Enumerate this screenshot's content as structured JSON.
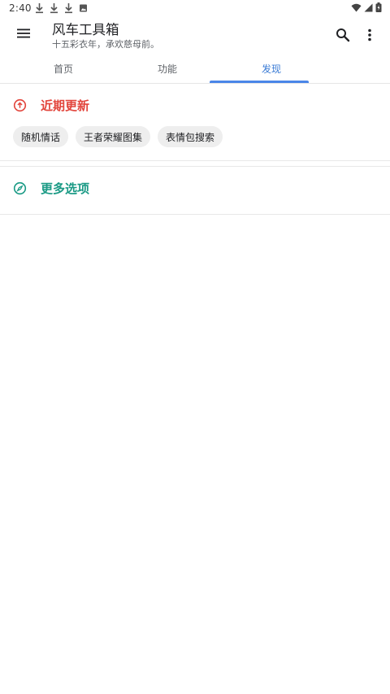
{
  "status_bar": {
    "time": "2:40",
    "left_icons": [
      "download-icon",
      "download-icon",
      "download-icon",
      "image-icon"
    ],
    "right_icons": [
      "wifi-icon",
      "cellular-signal-icon",
      "battery-icon"
    ]
  },
  "app_bar": {
    "title": "风车工具箱",
    "subtitle": "十五彩衣年，承欢慈母前。",
    "menu_icon": "menu-icon",
    "search_icon": "search-icon",
    "more_icon": "more-vert-icon"
  },
  "tabs": [
    {
      "label": "首页",
      "active": false
    },
    {
      "label": "功能",
      "active": false
    },
    {
      "label": "发现",
      "active": true
    }
  ],
  "sections": {
    "recent": {
      "title": "近期更新",
      "icon": "arrow-up-circle-icon",
      "color": "#e2453c",
      "chips": [
        "随机情话",
        "王者荣耀图集",
        "表情包搜索"
      ]
    },
    "more": {
      "title": "更多选项",
      "icon": "compass-icon",
      "color": "#1a9a85"
    }
  },
  "colors": {
    "accent": "#3a7bd5",
    "tab_indicator": "#4a86e8",
    "chip_bg": "#eeeeee"
  }
}
